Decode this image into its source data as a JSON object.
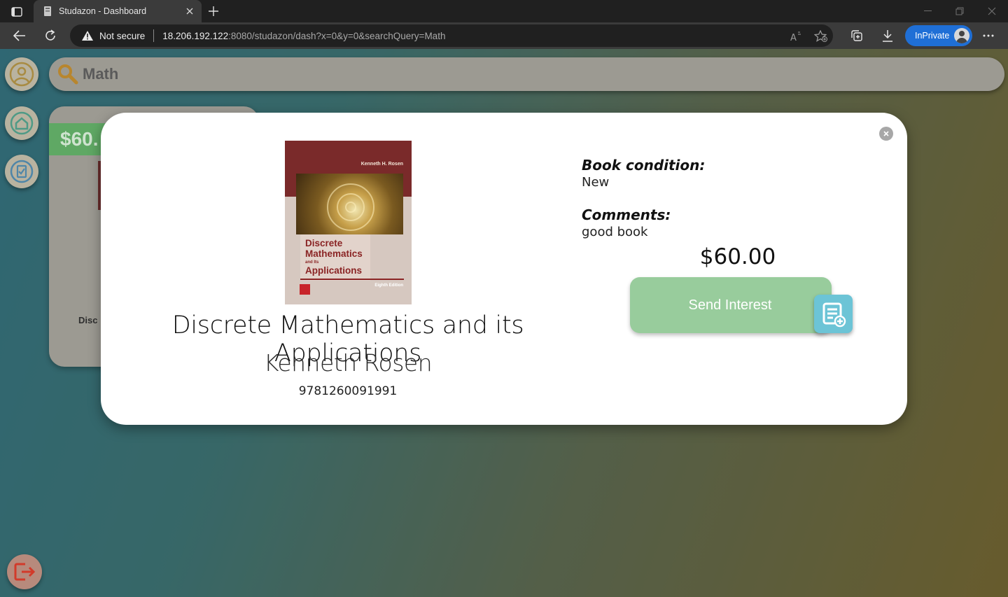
{
  "browser": {
    "tab_title": "Studazon - Dashboard",
    "security_label": "Not secure",
    "url_host": "18.206.192.122",
    "url_rest": ":8080/studazon/dash?x=0&y=0&searchQuery=Math",
    "inprivate_label": "InPrivate"
  },
  "search": {
    "query": "Math"
  },
  "background_card": {
    "price": "$60.",
    "title": "Disc"
  },
  "modal": {
    "cover": {
      "author": "Kenneth H. Rosen",
      "title_line1": "Discrete",
      "title_line2": "Mathematics",
      "title_small": "and Its",
      "title_line3": "Applications",
      "edition": "Eighth Edition"
    },
    "book_title": "Discrete Mathematics and its Applications",
    "author": "Kenneth Rosen",
    "isbn": "9781260091991",
    "condition_label": "Book condition:",
    "condition_value": "New",
    "comments_label": "Comments:",
    "comments_value": "good book",
    "price": "$60.00",
    "send_button_label": "Send Interest"
  },
  "colors": {
    "send_button": "#98cc9c",
    "send_icon": "#6cc4d6",
    "price_banner": "#5fa864",
    "inprivate": "#1f6fd6"
  }
}
